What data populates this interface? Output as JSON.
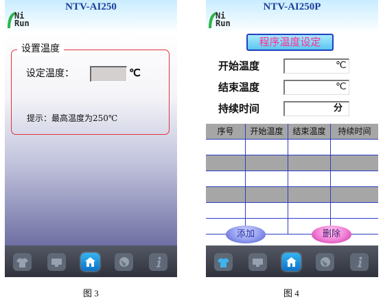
{
  "figure3": {
    "title": "NTV-AI250",
    "logo": {
      "line1": "Ni",
      "line2": "Run"
    },
    "group_title": "设置温度",
    "set_temp_label": "设定温度：",
    "set_temp_value": "",
    "unit": "℃",
    "hint": "提示：最高温度为250℃",
    "nav_icons": [
      "shirt-icon",
      "screen-icon",
      "home-icon",
      "globe-icon",
      "info-icon"
    ],
    "active_nav": "home-icon",
    "caption": "图 3"
  },
  "figure4": {
    "title": "NTV-AI250P",
    "logo": {
      "line1": "Ni",
      "line2": "Run"
    },
    "heading": "程序温度设定",
    "fields": [
      {
        "label": "开始温度",
        "value": "",
        "unit": "℃"
      },
      {
        "label": "结束温度",
        "value": "",
        "unit": "℃"
      },
      {
        "label": "持续时间",
        "value": "",
        "unit": "分"
      }
    ],
    "table": {
      "columns": [
        "序号",
        "开始温度",
        "结束温度",
        "持续时间"
      ],
      "rows": [
        [
          "",
          "",
          "",
          ""
        ],
        [
          "",
          "",
          "",
          ""
        ],
        [
          "",
          "",
          "",
          ""
        ],
        [
          "",
          "",
          "",
          ""
        ],
        [
          "",
          "",
          "",
          ""
        ],
        [
          "",
          "",
          "",
          ""
        ]
      ]
    },
    "add_label": "添加",
    "delete_label": "删除",
    "nav_icons": [
      "shirt-icon",
      "screen-icon",
      "home-icon",
      "globe-icon",
      "info-icon"
    ],
    "active_nav": "home-icon",
    "caption": "图 4"
  },
  "colors": {
    "title_text": "#1b3f9a",
    "group_border": "#e0303a",
    "heading_text": "#ff2e92",
    "table_grid": "#2a3cc0",
    "nav_active": "#1a8ee0",
    "logo_green": "#2fb34a"
  }
}
